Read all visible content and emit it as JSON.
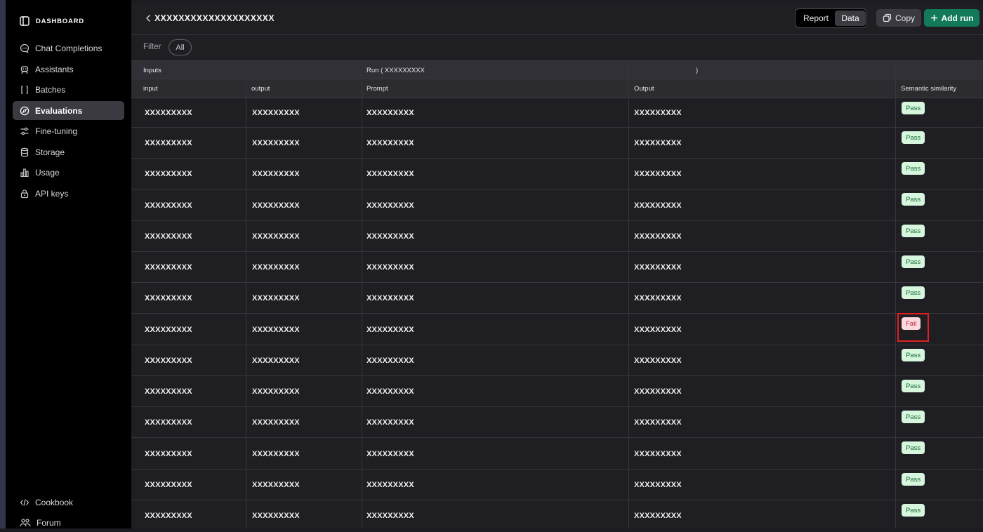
{
  "sidebar": {
    "brand": "DASHBOARD",
    "items": [
      {
        "label": "Chat Completions",
        "icon": "chat-bubble-icon",
        "active": false
      },
      {
        "label": "Assistants",
        "icon": "robot-icon",
        "active": false
      },
      {
        "label": "Batches",
        "icon": "brackets-icon",
        "active": false
      },
      {
        "label": "Evaluations",
        "icon": "compass-icon",
        "active": true
      },
      {
        "label": "Fine-tuning",
        "icon": "sliders-icon",
        "active": false
      },
      {
        "label": "Storage",
        "icon": "database-icon",
        "active": false
      },
      {
        "label": "Usage",
        "icon": "bar-chart-icon",
        "active": false
      },
      {
        "label": "API keys",
        "icon": "lock-icon",
        "active": false
      }
    ],
    "bottom": [
      {
        "label": "Cookbook",
        "icon": "code-icon"
      },
      {
        "label": "Forum",
        "icon": "people-icon"
      }
    ]
  },
  "header": {
    "title": "XXXXXXXXXXXXXXXXXXXX",
    "view_options": [
      "Report",
      "Data"
    ],
    "selected_view": "Data",
    "copy_label": "Copy",
    "add_run_label": "Add run"
  },
  "filter": {
    "label": "Filter",
    "value": "All"
  },
  "table": {
    "groups": [
      "Inputs",
      "Run ( XXXXXXXXX",
      ")"
    ],
    "columns": [
      "input",
      "output",
      "Prompt",
      "Output",
      "Semantic similarity"
    ],
    "rows": [
      [
        "XXXXXXXXX",
        "XXXXXXXXX",
        "XXXXXXXXX",
        "XXXXXXXXX",
        "Pass"
      ],
      [
        "XXXXXXXXX",
        "XXXXXXXXX",
        "XXXXXXXXX",
        "XXXXXXXXX",
        "Pass"
      ],
      [
        "XXXXXXXXX",
        "XXXXXXXXX",
        "XXXXXXXXX",
        "XXXXXXXXX",
        "Pass"
      ],
      [
        "XXXXXXXXX",
        "XXXXXXXXX",
        "XXXXXXXXX",
        "XXXXXXXXX",
        "Pass"
      ],
      [
        "XXXXXXXXX",
        "XXXXXXXXX",
        "XXXXXXXXX",
        "XXXXXXXXX",
        "Pass"
      ],
      [
        "XXXXXXXXX",
        "XXXXXXXXX",
        "XXXXXXXXX",
        "XXXXXXXXX",
        "Pass"
      ],
      [
        "XXXXXXXXX",
        "XXXXXXXXX",
        "XXXXXXXXX",
        "XXXXXXXXX",
        "Pass"
      ],
      [
        "XXXXXXXXX",
        "XXXXXXXXX",
        "XXXXXXXXX",
        "XXXXXXXXX",
        "Fail"
      ],
      [
        "XXXXXXXXX",
        "XXXXXXXXX",
        "XXXXXXXXX",
        "XXXXXXXXX",
        "Pass"
      ],
      [
        "XXXXXXXXX",
        "XXXXXXXXX",
        "XXXXXXXXX",
        "XXXXXXXXX",
        "Pass"
      ],
      [
        "XXXXXXXXX",
        "XXXXXXXXX",
        "XXXXXXXXX",
        "XXXXXXXXX",
        "Pass"
      ],
      [
        "XXXXXXXXX",
        "XXXXXXXXX",
        "XXXXXXXXX",
        "XXXXXXXXX",
        "Pass"
      ],
      [
        "XXXXXXXXX",
        "XXXXXXXXX",
        "XXXXXXXXX",
        "XXXXXXXXX",
        "Pass"
      ],
      [
        "XXXXXXXXX",
        "XXXXXXXXX",
        "XXXXXXXXX",
        "XXXXXXXXX",
        "Pass"
      ]
    ]
  },
  "colors": {
    "accent": "#13795b",
    "pass_bg": "#d6f6dd",
    "fail_bg": "#fdd8dc",
    "highlight": "#e02020"
  }
}
